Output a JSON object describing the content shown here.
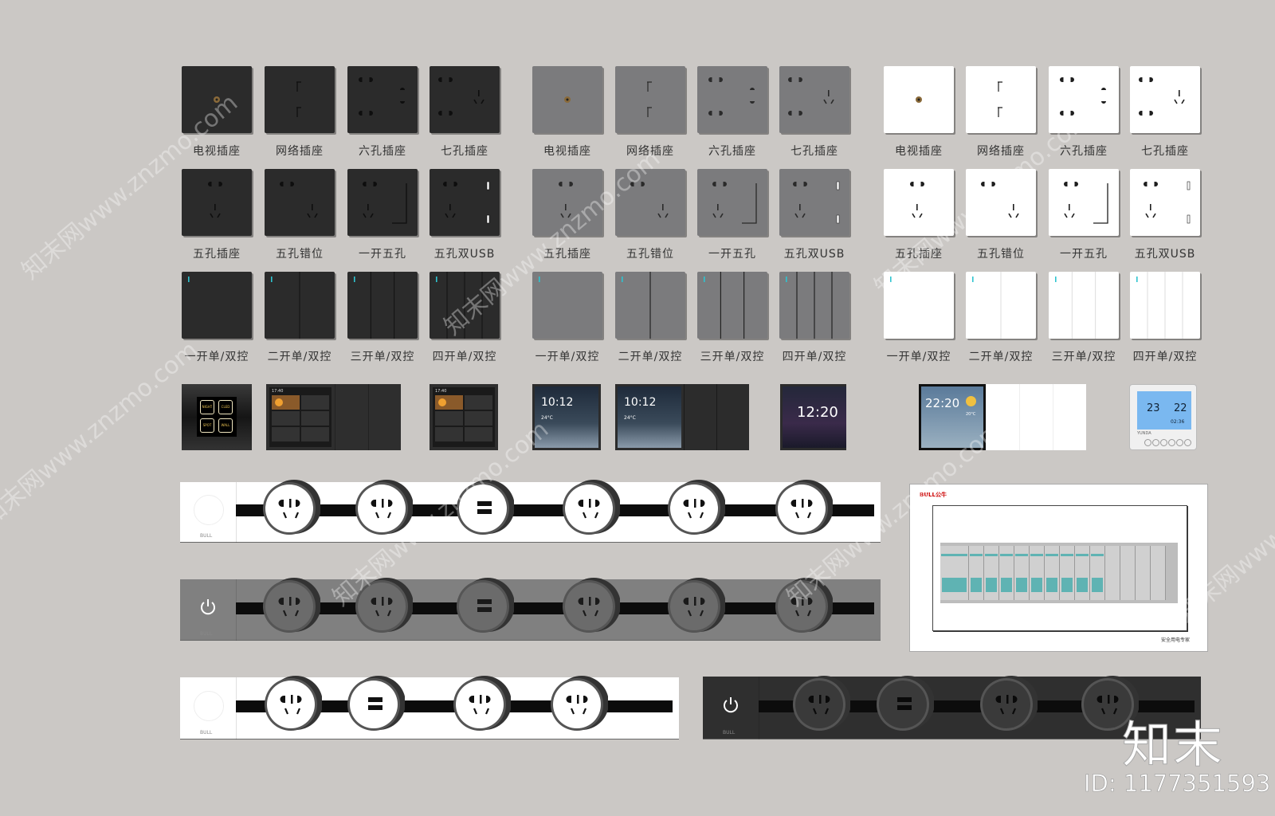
{
  "groups": [
    {
      "finish": "black",
      "face": "#2b2b2b",
      "slot": "#0e0e0e"
    },
    {
      "finish": "grey",
      "face": "#7b7b7d",
      "slot": "#2a2a2a"
    },
    {
      "finish": "white",
      "face": "#ffffff",
      "slot": "#1e1e1e"
    }
  ],
  "tile_rows": [
    {
      "items": [
        {
          "type": "tv",
          "label": "电视插座"
        },
        {
          "type": "network",
          "label": "网络插座"
        },
        {
          "type": "six",
          "label": "六孔插座"
        },
        {
          "type": "seven",
          "label": "七孔插座"
        }
      ]
    },
    {
      "items": [
        {
          "type": "five",
          "label": "五孔插座"
        },
        {
          "type": "five-offset",
          "label": "五孔错位"
        },
        {
          "type": "switch-five",
          "label": "一开五孔"
        },
        {
          "type": "five-usb",
          "label": "五孔双USB"
        }
      ]
    },
    {
      "items": [
        {
          "type": "gang1",
          "label": "一开单/双控"
        },
        {
          "type": "gang2",
          "label": "二开单/双控"
        },
        {
          "type": "gang3",
          "label": "三开单/双控"
        },
        {
          "type": "gang4",
          "label": "四开单/双控"
        }
      ]
    }
  ],
  "smart_panels": {
    "scene_buttons": [
      "NIGHT",
      "CLED",
      "SPOT",
      "WALL"
    ],
    "panel_a_status": "17:40",
    "panel_b_time": "10:12",
    "panel_b_weather": "24°C",
    "panel_c_time": "10:12",
    "panel_c_weather": "24°C",
    "panel_d_time": "12:20",
    "panel_e_time": "22:20",
    "panel_e_temp": "20°C",
    "thermostat": {
      "set_temp": "23",
      "room_temp": "22",
      "clock": "02:36",
      "brand": "YUNDA"
    }
  },
  "strips": {
    "brand": "BULL",
    "strip_1": [
      "ac",
      "ac",
      "usb",
      "ac",
      "ac",
      "ac"
    ],
    "strip_2": [
      "ac",
      "ac",
      "usb",
      "ac",
      "ac",
      "ac"
    ],
    "strip_3": [
      "ac",
      "usb",
      "ac",
      "ac"
    ],
    "strip_4": [
      "ac",
      "usb",
      "ac",
      "ac"
    ],
    "power_icon": "power-icon",
    "accent_rail": "#0c0c0c"
  },
  "breaker_box": {
    "brand": "BULL公牛",
    "footer": "安全用电专家",
    "breaker_count": 10,
    "blank_count": 4,
    "accent": "#5fb3b3"
  },
  "watermark": {
    "text": "知末网www.znzmo.com",
    "logo": "知末",
    "id": "ID: 1177351593"
  }
}
